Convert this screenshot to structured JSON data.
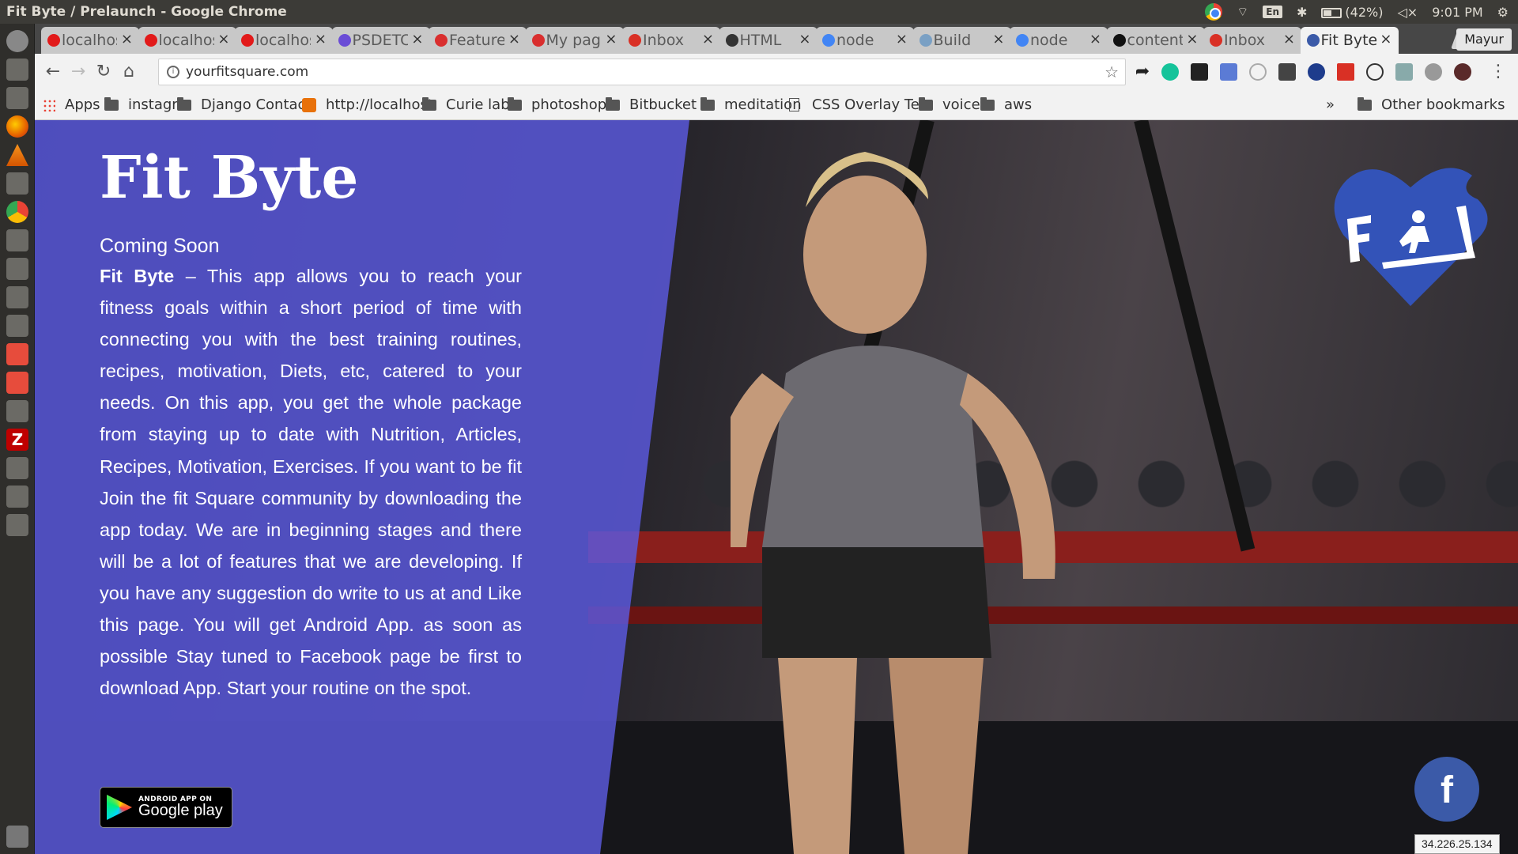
{
  "os": {
    "window_title": "Fit Byte / Prelaunch - Google Chrome",
    "keyboard_layout": "En",
    "battery": "(42%)",
    "time": "9:01 PM"
  },
  "tabs": [
    {
      "label": "localhost",
      "icon": "opera-icon",
      "color": "#e21a1a"
    },
    {
      "label": "localhost",
      "icon": "opera-icon",
      "color": "#e21a1a"
    },
    {
      "label": "localhost",
      "icon": "opera-icon",
      "color": "#e21a1a"
    },
    {
      "label": "PSDETCH",
      "icon": "psd-icon",
      "color": "#6a4cd6"
    },
    {
      "label": "Feature",
      "icon": "rainbow-icon",
      "color": "#d92e2e"
    },
    {
      "label": "My page",
      "icon": "rainbow-icon",
      "color": "#d92e2e"
    },
    {
      "label": "Inbox",
      "icon": "gmail-icon",
      "color": "#d93025"
    },
    {
      "label": "HTML",
      "icon": "pug-icon",
      "color": "#333333"
    },
    {
      "label": "node",
      "icon": "google-icon",
      "color": "#4285f4"
    },
    {
      "label": "Build",
      "icon": "build-icon",
      "color": "#7aa0c4"
    },
    {
      "label": "node",
      "icon": "google-icon",
      "color": "#4285f4"
    },
    {
      "label": "content",
      "icon": "github-icon",
      "color": "#111111"
    },
    {
      "label": "Inbox",
      "icon": "gmail-icon",
      "color": "#d93025"
    },
    {
      "label": "Fit Byte",
      "icon": "fit-byte-icon",
      "color": "#3b5aa8",
      "active": true
    }
  ],
  "tab_close": "×",
  "profile_name": "Mayur",
  "toolbar": {
    "url": "yourfitsquare.com"
  },
  "bookmarks": [
    {
      "label": "Apps",
      "icon": "apps-grid-icon"
    },
    {
      "label": "instagr",
      "icon": "folder-icon"
    },
    {
      "label": "Django Contact",
      "icon": "folder-icon"
    },
    {
      "label": "http://localhost:",
      "icon": "localhost-icon"
    },
    {
      "label": "Curie lab",
      "icon": "folder-icon"
    },
    {
      "label": "photoshop",
      "icon": "folder-icon"
    },
    {
      "label": "Bitbucket",
      "icon": "folder-icon"
    },
    {
      "label": "meditation",
      "icon": "folder-icon"
    },
    {
      "label": "CSS Overlay Tec",
      "icon": "page-icon"
    },
    {
      "label": "voice",
      "icon": "folder-icon"
    },
    {
      "label": "aws",
      "icon": "folder-icon"
    },
    {
      "label": "»",
      "icon": "chevron-icon"
    },
    {
      "label": "Other bookmarks",
      "icon": "folder-icon"
    }
  ],
  "page": {
    "title": "Fit Byte",
    "coming_soon": "Coming Soon",
    "brand_bold": "Fit Byte",
    "description": " – This app allows you to reach your fitness goals within a short period of time with connecting you with the best training routines, recipes, motivation, Diets, etc, catered to your needs. On this app, you get the whole package from staying up to date with Nutrition, Articles, Recipes, Motivation, Exercises. If you want to be fit Join the fit Square community by downloading the app today. We are in beginning stages and there will be a lot of features that we are developing. If you have any suggestion do write to us at and Like this page. You will get Android App. as soon as possible Stay tuned to Facebook page be first to download App. Start your routine on the spot.",
    "store_badge_small": "ANDROID APP ON",
    "store_badge_big": "Google play",
    "facebook_glyph": "f",
    "ip_tooltip": "34.226.25.134",
    "overlay_color": "#5c5ae1"
  }
}
